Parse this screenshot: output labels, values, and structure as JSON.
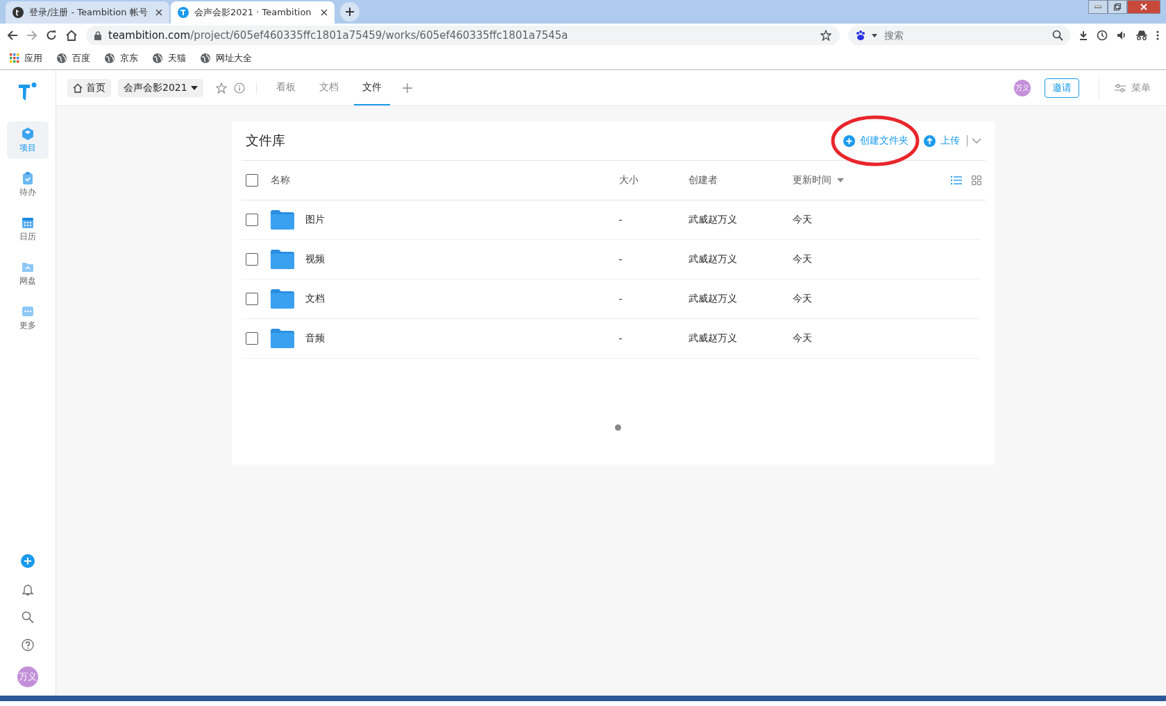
{
  "browser": {
    "tabs": [
      {
        "title": "登录/注册 - Teambition 帐号",
        "selected": false
      },
      {
        "title": "会声会影2021 · Teambition",
        "selected": true
      }
    ],
    "address": {
      "host": "teambition.com",
      "path": "/project/605ef460335ffc1801a75459/works/605ef460335ffc1801a7545a"
    },
    "search": {
      "placeholder": "搜索"
    },
    "bookmarks": [
      {
        "label": "应用",
        "kind": "apps"
      },
      {
        "label": "百度",
        "kind": "site"
      },
      {
        "label": "京东",
        "kind": "site"
      },
      {
        "label": "天猫",
        "kind": "site"
      },
      {
        "label": "网址大全",
        "kind": "site"
      }
    ]
  },
  "sidebar": {
    "items": [
      {
        "label": "项目",
        "kind": "project",
        "selected": true
      },
      {
        "label": "待办",
        "kind": "todo",
        "selected": false
      },
      {
        "label": "日历",
        "kind": "calendar",
        "selected": false
      },
      {
        "label": "网盘",
        "kind": "drive",
        "selected": false
      },
      {
        "label": "更多",
        "kind": "more",
        "selected": false
      }
    ],
    "avatar": "万义"
  },
  "header": {
    "home": "首页",
    "project": "会声会影2021",
    "tabs": [
      {
        "label": "看板",
        "selected": false
      },
      {
        "label": "文档",
        "selected": false
      },
      {
        "label": "文件",
        "selected": true
      }
    ],
    "avatar": "万义",
    "invite": "邀请",
    "menu": "菜单"
  },
  "library": {
    "title": "文件库",
    "create_folder": "创建文件夹",
    "upload": "上传",
    "select_all_checked": false,
    "columns": [
      "名称",
      "大小",
      "创建者",
      "更新时间"
    ],
    "rows": [
      {
        "name": "图片",
        "size": "-",
        "creator": "武威赵万义",
        "updated": "今天",
        "checked": false
      },
      {
        "name": "视频",
        "size": "-",
        "creator": "武威赵万义",
        "updated": "今天",
        "checked": false
      },
      {
        "name": "文档",
        "size": "-",
        "creator": "武威赵万义",
        "updated": "今天",
        "checked": false
      },
      {
        "name": "音频",
        "size": "-",
        "creator": "武威赵万义",
        "updated": "今天",
        "checked": false
      }
    ]
  }
}
